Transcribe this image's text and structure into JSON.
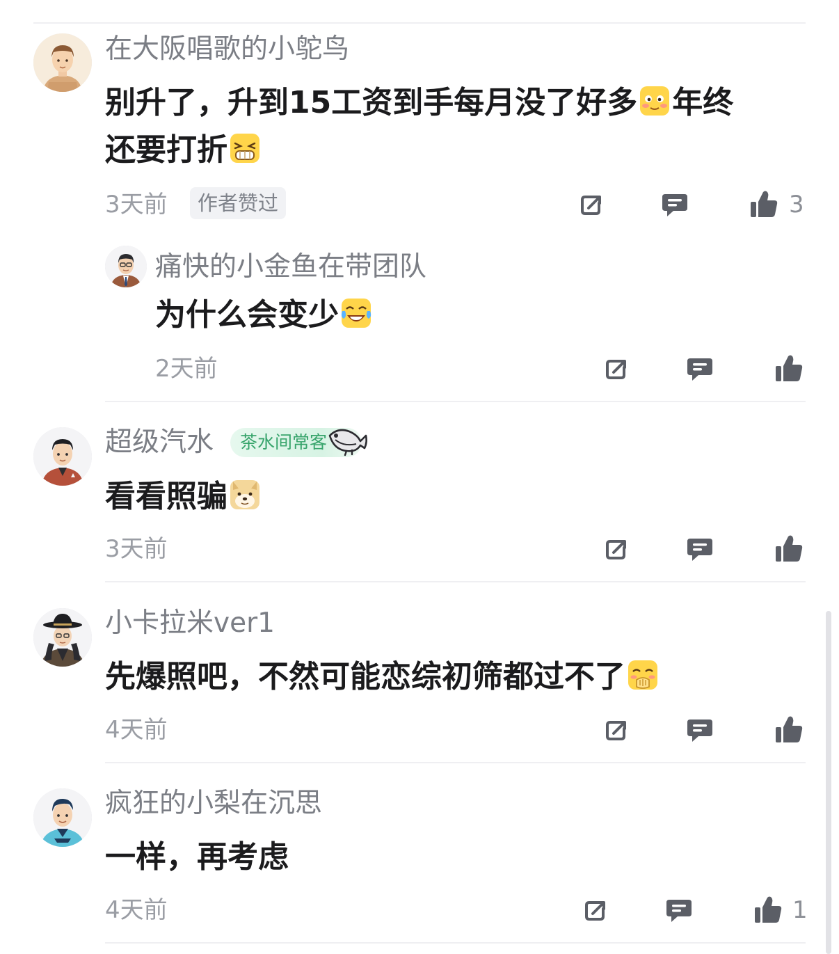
{
  "comments": [
    {
      "username": "在大阪唱歌的小鸵鸟",
      "text_1": "别升了，升到15工资到手每月没了好多",
      "text_2": "年终",
      "text_3": "还要打折",
      "time": "3天前",
      "badge": "作者赞过",
      "like_count": "3",
      "emoji_1": "shy-face-emoji",
      "emoji_2": "grin-squint-emoji"
    },
    {
      "username": "痛快的小金鱼在带团队",
      "text": "为什么会变少",
      "time": "2天前",
      "emoji": "tears-of-joy-emoji"
    },
    {
      "username": "超级汽水",
      "badge": "茶水间常客",
      "text": "看看照骗",
      "time": "3天前",
      "emoji": "doge-emoji"
    },
    {
      "username": "小卡拉米ver1",
      "text": "先爆照吧，不然可能恋综初筛都过不了",
      "time": "4天前",
      "emoji": "hand-over-mouth-emoji"
    },
    {
      "username": "疯狂的小梨在沉思",
      "text": "一样，再考虑",
      "time": "4天前",
      "like_count": "1"
    }
  ],
  "colors": {
    "username": "#7b7e85",
    "body": "#1b1b1d",
    "meta": "#9a9da4",
    "icon": "#5b5e66",
    "divider": "#efeff2",
    "badge_green": "#37a46b"
  }
}
